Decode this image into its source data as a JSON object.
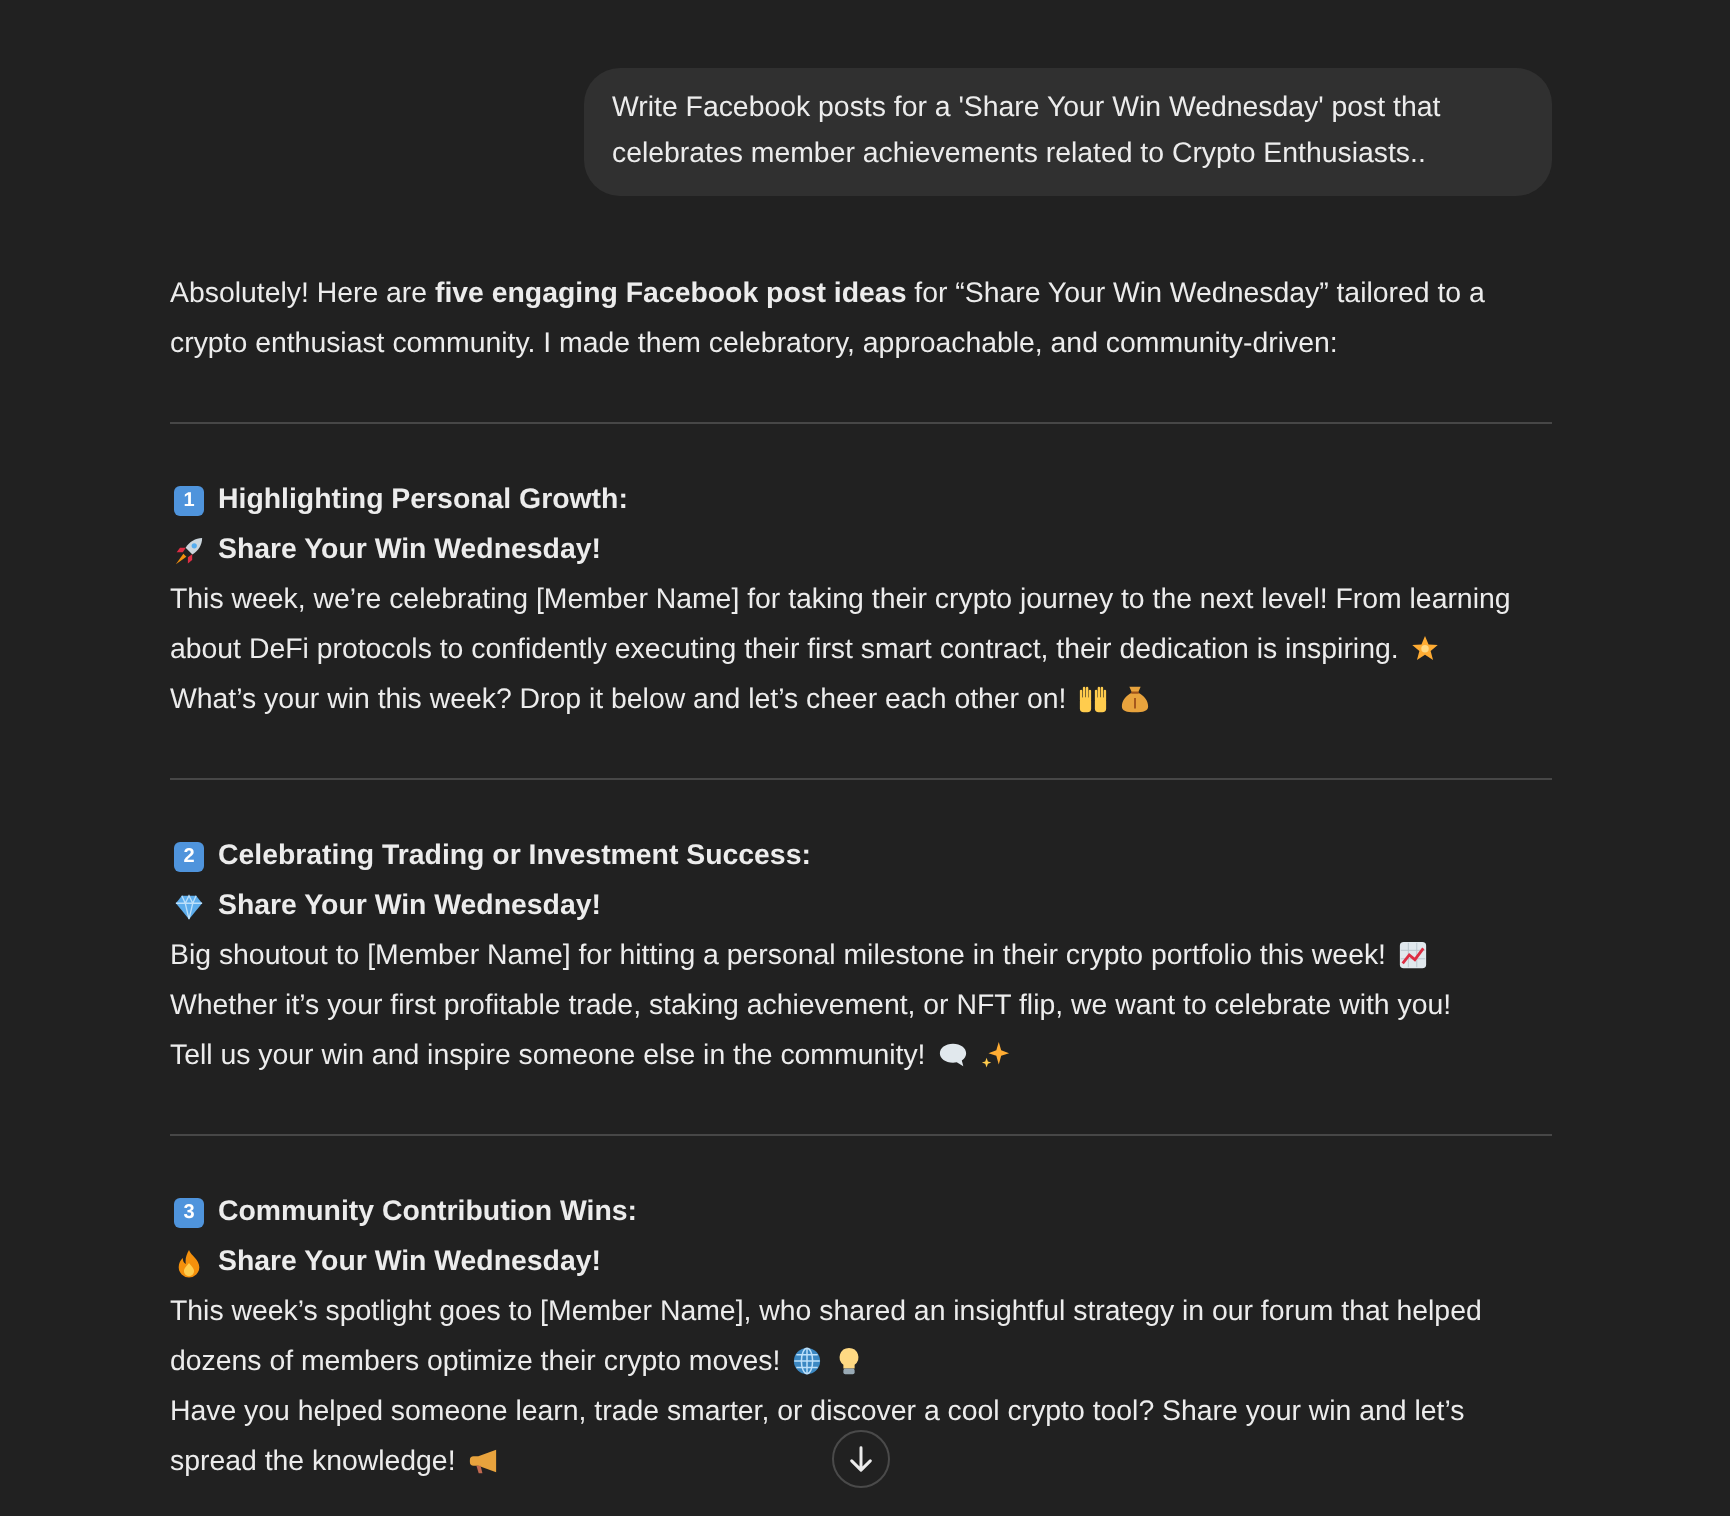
{
  "user_message": {
    "text": "Write Facebook posts for a 'Share Your Win Wednesday' post that celebrates member achievements related to Crypto Enthusiasts.."
  },
  "assistant_message": {
    "intro": "Absolutely! Here are **five engaging Facebook post ideas** for “Share Your Win Wednesday” tailored to a crypto enthusiast community. I made them celebratory, approachable, and community-driven:",
    "posts": [
      {
        "number": "1",
        "heading": "Highlighting Personal Growth:",
        "title": "Share Your Win Wednesday!",
        "lines": [
          "This week, we’re celebrating [Member Name] for taking their crypto journey to the next level! From learning",
          "about DeFi protocols to confidently executing their first smart contract, their dedication is inspiring.",
          "What’s your win this week? Drop it below and let’s cheer each other on!"
        ]
      },
      {
        "number": "2",
        "heading": "Celebrating Trading or Investment Success:",
        "title": "Share Your Win Wednesday!",
        "lines": [
          "Big shoutout to [Member Name] for hitting a personal milestone in their crypto portfolio this week!",
          "Whether it’s your first profitable trade, staking achievement, or NFT flip, we want to celebrate with you!",
          "Tell us your win and inspire someone else in the community!"
        ]
      },
      {
        "number": "3",
        "heading": "Community Contribution Wins:",
        "title": "Share Your Win Wednesday!",
        "lines": [
          "This week’s spotlight goes to [Member Name], who shared an insightful strategy in our forum that helped",
          "dozens of members optimize their crypto moves!",
          "Have you helped someone learn, trade smarter, or discover a cool crypto tool? Share your win and let’s",
          "spread the knowledge!"
        ]
      }
    ]
  }
}
